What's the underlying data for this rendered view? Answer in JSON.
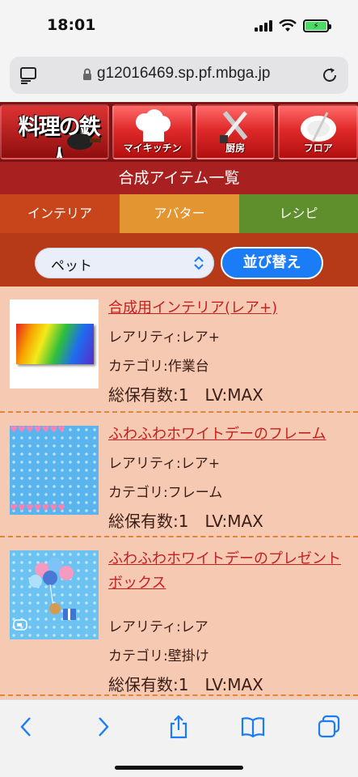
{
  "status": {
    "time": "18:01",
    "battery_icon": "battery-charging-icon"
  },
  "browser": {
    "url": "g12016469.sp.pf.mbga.jp"
  },
  "game_nav": {
    "logo_text": "料理の鉄人",
    "buttons": [
      {
        "label": "マイキッチン"
      },
      {
        "label": "厨房"
      },
      {
        "label": "フロア"
      }
    ]
  },
  "page": {
    "title": "合成アイテム一覧"
  },
  "tabs": [
    {
      "label": "インテリア"
    },
    {
      "label": "アバター"
    },
    {
      "label": "レシピ"
    }
  ],
  "filter": {
    "selected": "ペット",
    "sort_label": "並び替え"
  },
  "items": [
    {
      "name": "合成用インテリア(レア+)",
      "rarity": "レアリティ:レア+",
      "category": "カテゴリ:作業台",
      "count_level": "総保有数:1　LV:MAX"
    },
    {
      "name": "ふわふわホワイトデーのフレーム",
      "rarity": "レアリティ:レア+",
      "category": "カテゴリ:フレーム",
      "count_level": "総保有数:1　LV:MAX"
    },
    {
      "name": "ふわふわホワイトデーのプレゼントボックス",
      "rarity": "レアリティ:レア",
      "category": "カテゴリ:壁掛け",
      "count_level": "総保有数:1　LV:MAX"
    }
  ],
  "colors": {
    "accent_red": "#c62020",
    "tab_interior": "#c8441a",
    "tab_avatar": "#e39532",
    "tab_recipe": "#5f8e2c",
    "sort_button": "#1a7df7"
  }
}
